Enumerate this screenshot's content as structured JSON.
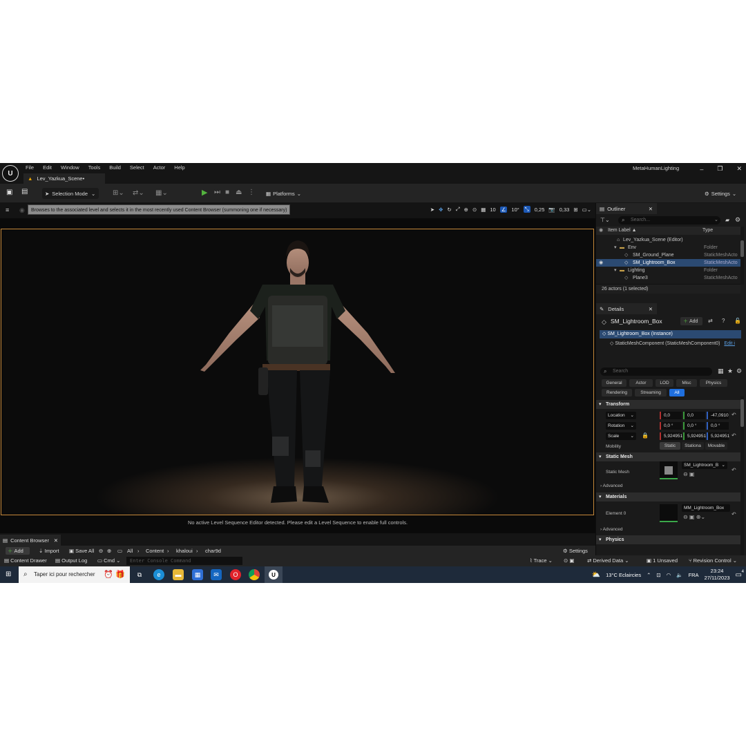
{
  "menubar": {
    "items": [
      "File",
      "Edit",
      "Window",
      "Tools",
      "Build",
      "Select",
      "Actor",
      "Help"
    ],
    "app_name": "MetaHumanLighting"
  },
  "tab": {
    "label": "Lev_Yazkua_Scene•"
  },
  "toolbar": {
    "selection_mode": "Selection Mode",
    "platforms": "Platforms",
    "settings": "Settings"
  },
  "viewport": {
    "tooltip": "Browses to the associated level and selects it in the most recently used Content Browser (summoning one if necessary)",
    "grid_snap": "10",
    "rot_snap": "10°",
    "scale_snap": "0,25",
    "cam_speed": "0,33",
    "sequence_msg": "No active Level Sequence Editor detected. Please edit a Level Sequence to enable full controls."
  },
  "outliner": {
    "title": "Outliner",
    "search_placeholder": "Search...",
    "col_label": "Item Label ▲",
    "col_type": "Type",
    "rows": [
      {
        "label": "Lev_Yazkua_Scene (Editor)",
        "type": ""
      },
      {
        "label": "Env",
        "type": "Folder"
      },
      {
        "label": "SM_Ground_Plane",
        "type": "StaticMeshActo"
      },
      {
        "label": "SM_Lightroom_Box",
        "type": "StaticMeshActo"
      },
      {
        "label": "Lighting",
        "type": "Folder"
      },
      {
        "label": "Plane3",
        "type": "StaticMeshActo"
      }
    ],
    "count": "26 actors (1 selected)"
  },
  "details": {
    "title": "Details",
    "object": "SM_Lightroom_Box",
    "add": "Add",
    "instance": "SM_Lightroom_Box (Instance)",
    "component": "StaticMeshComponent (StaticMeshComponent0)",
    "edit": "Edit i",
    "search_placeholder": "Search",
    "filters": [
      "General",
      "Actor",
      "LOD",
      "Misc",
      "Physics",
      "Rendering",
      "Streaming",
      "All"
    ],
    "transform": "Transform",
    "location": {
      "label": "Location",
      "x": "0,0",
      "y": "0,0",
      "z": "-47,0910"
    },
    "rotation": {
      "label": "Rotation",
      "x": "0,0 °",
      "y": "0,0 °",
      "z": "0,0 °"
    },
    "scale": {
      "label": "Scale",
      "x": "5,924951",
      "y": "5,924951",
      "z": "5,924951"
    },
    "mobility": {
      "label": "Mobility",
      "opts": [
        "Static",
        "Stationa",
        "Movable"
      ]
    },
    "static_mesh_section": "Static Mesh",
    "static_mesh_label": "Static Mesh",
    "static_mesh_value": "SM_Lightroom_B",
    "advanced": "Advanced",
    "materials": "Materials",
    "element0": "Element 0",
    "material_value": "MM_Lightroom_Box",
    "physics": "Physics"
  },
  "content_browser": {
    "tab": "Content Browser",
    "add": "Add",
    "import": "Import",
    "save_all": "Save All",
    "path": [
      "All",
      "Content",
      "khaloui",
      "char9d"
    ],
    "settings": "Settings"
  },
  "statusbar": {
    "content_drawer": "Content Drawer",
    "output_log": "Output Log",
    "cmd": "Cmd",
    "console_placeholder": "Enter Console Command",
    "trace": "Trace",
    "derived": "Derived Data",
    "unsaved": "1 Unsaved",
    "revision": "Revision Control"
  },
  "taskbar": {
    "search": "Taper ici pour rechercher",
    "weather": "13°C  Eclaircies",
    "lang": "FRA",
    "time": "23:24",
    "date": "27/11/2023",
    "notif": "4"
  }
}
